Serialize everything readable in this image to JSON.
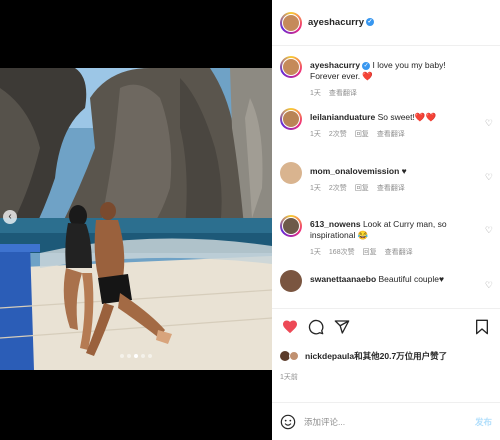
{
  "post": {
    "author": "ayeshacurry",
    "verified_mark": "✓"
  },
  "media": {
    "prev_icon": "chevron-left-icon",
    "prev_glyph": "‹",
    "slide_count": 5,
    "active_slide": 2
  },
  "comments": [
    {
      "username": "ayeshacurry",
      "text": "I love you my baby! Forever ever. ❤️",
      "time": "1天",
      "likes": "",
      "translate": "查看翻译",
      "verified": true,
      "avatar_color": "#c58a5a",
      "story": true
    },
    {
      "username": "leilanianduature",
      "text": "So sweet!❤️❤️",
      "time": "1天",
      "likes": "2次赞",
      "reply": "回复",
      "translate": "查看翻译",
      "avatar_color": "#b98456",
      "story": true
    },
    {
      "username": "mom_onalovemission",
      "text": "♥",
      "time": "1天",
      "likes": "2次赞",
      "reply": "回复",
      "translate": "查看翻译",
      "avatar_color": "#d9b48f",
      "story": false
    },
    {
      "username": "613_nowens",
      "text": "Look at Curry man, so inspirational 😂",
      "time": "1天",
      "likes": "168次赞",
      "reply": "回复",
      "translate": "查看翻译",
      "avatar_color": "#6d5a4a",
      "story": true
    },
    {
      "username": "swanettaanaebo",
      "text": "Beautiful couple♥",
      "time": "",
      "likes": "",
      "reply": "",
      "translate": "",
      "avatar_color": "#7a5540",
      "story": false
    }
  ],
  "actions": {
    "like_icon": "heart-filled-icon",
    "comment_icon": "comment-icon",
    "share_icon": "share-icon",
    "save_icon": "bookmark-icon",
    "like_color": "#ed4956"
  },
  "likes_summary": {
    "text": "nickdepaula和其他20.7万位用户赞了"
  },
  "date": "1天前",
  "add_comment": {
    "placeholder": "添加评论...",
    "post_label": "发布",
    "emoji_icon": "emoji-icon"
  }
}
